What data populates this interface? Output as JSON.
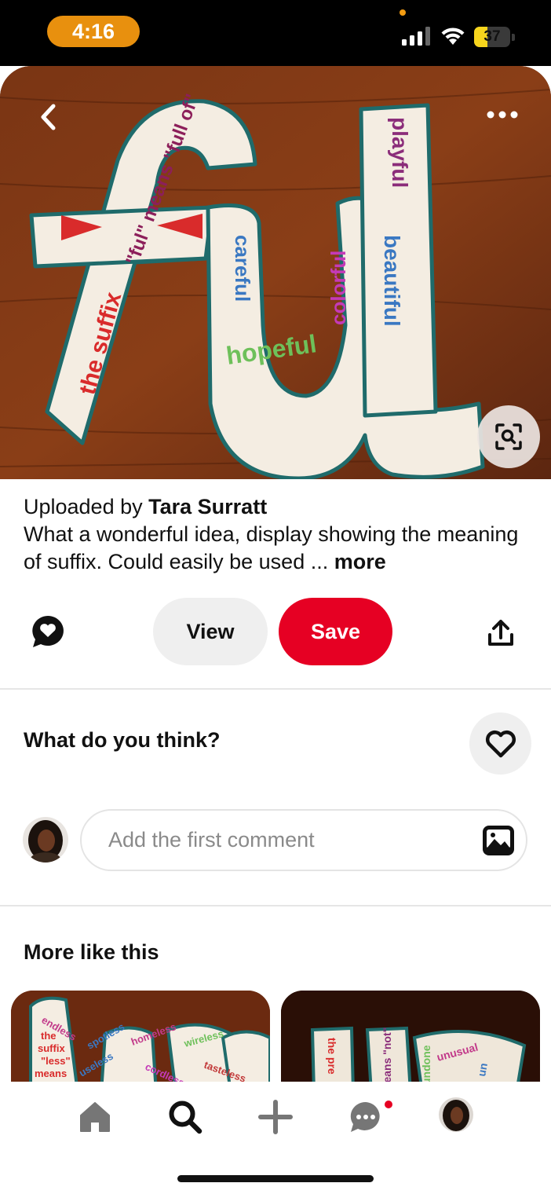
{
  "status_bar": {
    "time": "4:16",
    "battery": "37",
    "battery_percent": 37,
    "icons": [
      "signal-icon",
      "wifi-icon",
      "battery-icon"
    ],
    "colors": {
      "time_pill": "#e8900e",
      "battery_fill": "#f7d51d"
    }
  },
  "pin": {
    "image_words": [
      "the suffix",
      "\"ful\" means \"full of\"",
      "careful",
      "hopeful",
      "colorful",
      "playful",
      "beautiful"
    ],
    "uploaded_prefix": "Uploaded by",
    "uploader": "Tara Surratt",
    "description": "What a wonderful idea, display showing the meaning of suffix. Could easily be used ...",
    "more_label": "more",
    "icons": {
      "back": "chevron-left-icon",
      "options": "ellipsis-icon",
      "lens": "visual-search-icon"
    }
  },
  "actions": {
    "view_label": "View",
    "save_label": "Save",
    "icons": {
      "comment": "comment-bubble-icon",
      "share": "share-icon"
    },
    "colors": {
      "save": "#e60023",
      "view": "#efefef"
    }
  },
  "comments": {
    "prompt": "What do you think?",
    "placeholder": "Add the first comment",
    "icons": {
      "react": "heart-outline-icon",
      "image": "image-icon"
    }
  },
  "related": {
    "title": "More like this",
    "cards": [
      {
        "words": [
          "endless",
          "the suffix \"less\" means \"without\"",
          "spotless",
          "homeless",
          "wireless",
          "useless",
          "cordless",
          "tasteless"
        ]
      },
      {
        "words": [
          "the pre",
          "means \"not\"",
          "undone",
          "unusual",
          "un"
        ]
      }
    ]
  },
  "tab_bar": {
    "tabs": [
      "home-icon",
      "search-icon",
      "create-icon",
      "messages-icon",
      "profile-avatar"
    ],
    "active": "search-icon",
    "has_notification": true
  }
}
